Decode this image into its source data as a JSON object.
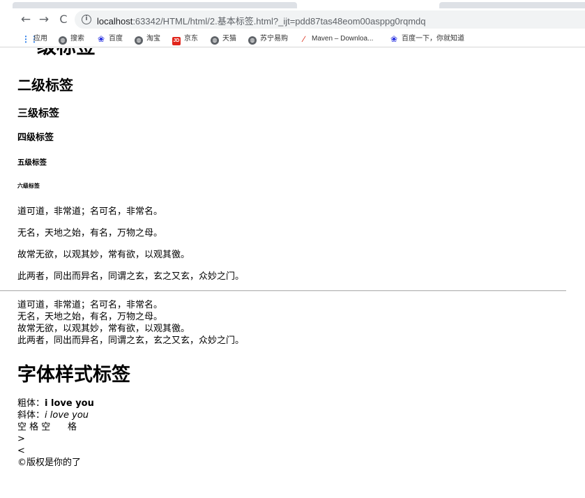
{
  "browser": {
    "url_host": "localhost",
    "url_rest": ":63342/HTML/html/2.基本标签.html?_ijt=pdd87tas48eom00asppg0rqmdq",
    "nav": {
      "back": "←",
      "forward": "→",
      "reload": "C"
    },
    "bookmarks": [
      {
        "label": "应用",
        "icon": "apps-grid-icon"
      },
      {
        "label": "搜索",
        "icon": "globe-icon"
      },
      {
        "label": "百度",
        "icon": "baidu-paw-icon"
      },
      {
        "label": "淘宝",
        "icon": "globe-icon"
      },
      {
        "label": "京东",
        "icon": "jd-icon"
      },
      {
        "label": "天猫",
        "icon": "globe-icon"
      },
      {
        "label": "苏宁易购",
        "icon": "globe-icon"
      },
      {
        "label": "Maven – Downloa...",
        "icon": "maven-feather-icon"
      },
      {
        "label": "百度一下，你就知道",
        "icon": "baidu-paw-icon"
      }
    ]
  },
  "page": {
    "headings": {
      "h1": "一级标签",
      "h2": "二级标签",
      "h3": "三级标签",
      "h4": "四级标签",
      "h5": "五级标签",
      "h6": "六级标签"
    },
    "paragraphs": [
      "道可道，非常道；名可名，非常名。",
      "无名，天地之始，有名，万物之母。",
      "故常无欲，以观其妙，常有欲，以观其徼。",
      "此两者，同出而异名，同谓之玄，玄之又玄，众妙之门。"
    ],
    "lines": [
      "道可道，非常道；名可名，非常名。",
      "无名，天地之始，有名，万物之母。",
      "故常无欲，以观其妙，常有欲，以观其徼。",
      "此两者，同出而异名，同谓之玄，玄之又玄，众妙之门。"
    ],
    "font_section": {
      "title": "字体样式标签",
      "bold_label": "粗体：",
      "bold_value": "i love you",
      "italic_label": "斜体：",
      "italic_value": "i love you",
      "spaces": "空 格 空      格",
      "gt": ">",
      "lt": "<",
      "copyright": "©版权是你的了"
    }
  }
}
